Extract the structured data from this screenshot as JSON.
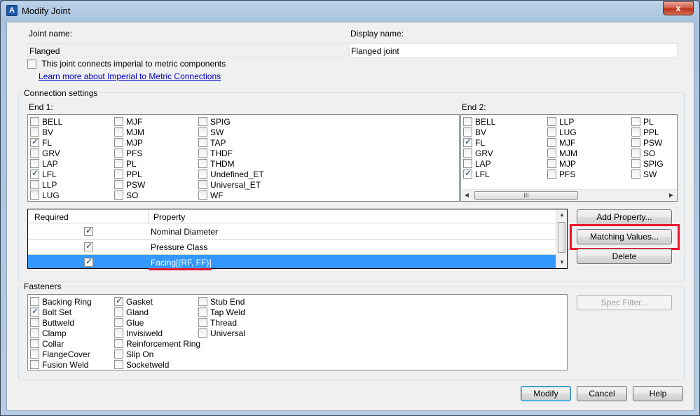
{
  "window": {
    "title": "Modify Joint",
    "close_glyph": "x"
  },
  "joint": {
    "name_label": "Joint name:",
    "name_value": "Flanged",
    "display_label": "Display name:",
    "display_value": "Flanged joint",
    "imperial_checkbox_label": "This joint connects imperial to metric components",
    "imperial_checked": false,
    "learn_more_link": "Learn more about Imperial to Metric Connections"
  },
  "connection": {
    "group_title": "Connection settings",
    "end1_label": "End 1:",
    "end2_label": "End 2:",
    "end1_items": [
      {
        "label": "BELL",
        "checked": false
      },
      {
        "label": "BV",
        "checked": false
      },
      {
        "label": "FL",
        "checked": true
      },
      {
        "label": "GRV",
        "checked": false
      },
      {
        "label": "LAP",
        "checked": false
      },
      {
        "label": "LFL",
        "checked": true
      },
      {
        "label": "LLP",
        "checked": false
      },
      {
        "label": "LUG",
        "checked": false
      },
      {
        "label": "MJF",
        "checked": false
      },
      {
        "label": "MJM",
        "checked": false
      },
      {
        "label": "MJP",
        "checked": false
      },
      {
        "label": "PFS",
        "checked": false
      },
      {
        "label": "PL",
        "checked": false
      },
      {
        "label": "PPL",
        "checked": false
      },
      {
        "label": "PSW",
        "checked": false
      },
      {
        "label": "SO",
        "checked": false
      },
      {
        "label": "SPIG",
        "checked": false
      },
      {
        "label": "SW",
        "checked": false
      },
      {
        "label": "TAP",
        "checked": false
      },
      {
        "label": "THDF",
        "checked": false
      },
      {
        "label": "THDM",
        "checked": false
      },
      {
        "label": "Undefined_ET",
        "checked": false
      },
      {
        "label": "Universal_ET",
        "checked": false
      },
      {
        "label": "WF",
        "checked": false
      }
    ],
    "end2_items": [
      {
        "label": "BELL",
        "checked": false
      },
      {
        "label": "BV",
        "checked": false
      },
      {
        "label": "FL",
        "checked": true
      },
      {
        "label": "GRV",
        "checked": false
      },
      {
        "label": "LAP",
        "checked": false
      },
      {
        "label": "LFL",
        "checked": true
      },
      {
        "label": "LLP",
        "checked": false
      },
      {
        "label": "LUG",
        "checked": false
      },
      {
        "label": "MJF",
        "checked": false
      },
      {
        "label": "MJM",
        "checked": false
      },
      {
        "label": "MJP",
        "checked": false
      },
      {
        "label": "PFS",
        "checked": false
      },
      {
        "label": "PL",
        "checked": false
      },
      {
        "label": "PPL",
        "checked": false
      },
      {
        "label": "PSW",
        "checked": false
      },
      {
        "label": "SO",
        "checked": false
      },
      {
        "label": "SPIG",
        "checked": false
      },
      {
        "label": "SW",
        "checked": false
      }
    ],
    "hscroll_grip": "III"
  },
  "properties": {
    "columns": [
      "Required",
      "Property"
    ],
    "rows": [
      {
        "required": true,
        "property": "Nominal Diameter",
        "selected": false
      },
      {
        "required": true,
        "property": "Pressure Class",
        "selected": false
      },
      {
        "required": true,
        "property": "Facing[(RF, FF)]",
        "selected": true
      }
    ],
    "add_button": "Add Property...",
    "matching_button": "Matching Values...",
    "delete_button": "Delete"
  },
  "fasteners": {
    "group_title": "Fasteners",
    "items": [
      {
        "label": "Backing Ring",
        "checked": false
      },
      {
        "label": "Bolt Set",
        "checked": true
      },
      {
        "label": "Buttweld",
        "checked": false
      },
      {
        "label": "Clamp",
        "checked": false
      },
      {
        "label": "Collar",
        "checked": false
      },
      {
        "label": "FlangeCover",
        "checked": false
      },
      {
        "label": "Fusion Weld",
        "checked": false
      },
      {
        "label": "Gasket",
        "checked": true
      },
      {
        "label": "Gland",
        "checked": false
      },
      {
        "label": "Glue",
        "checked": false
      },
      {
        "label": "Invisiweld",
        "checked": false
      },
      {
        "label": "Reinforcement Ring",
        "checked": false
      },
      {
        "label": "Slip On",
        "checked": false
      },
      {
        "label": "Socketweld",
        "checked": false
      },
      {
        "label": "Stub End",
        "checked": false
      },
      {
        "label": "Tap Weld",
        "checked": false
      },
      {
        "label": "Thread",
        "checked": false
      },
      {
        "label": "Universal",
        "checked": false
      }
    ],
    "spec_filter_button": "Spec Filter..."
  },
  "footer": {
    "modify_button": "Modify",
    "cancel_button": "Cancel",
    "help_button": "Help"
  },
  "colors": {
    "accent_highlight": "#e8142c",
    "selection": "#3399ff",
    "link": "#0000cc"
  }
}
